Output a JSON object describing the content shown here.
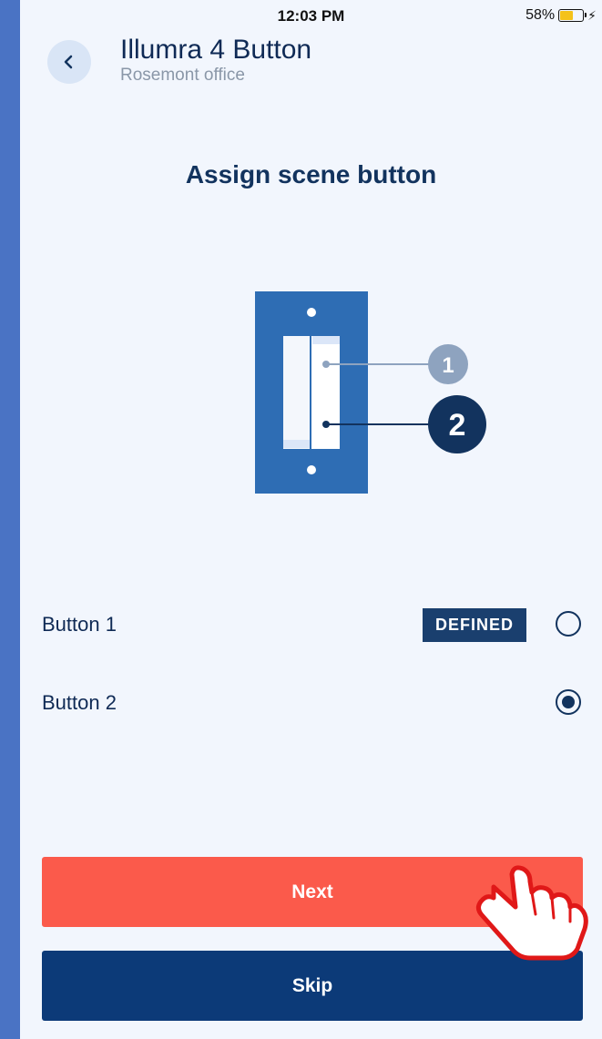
{
  "status_bar": {
    "time": "12:03 PM",
    "battery_percent": "58%",
    "battery_level": 0.58
  },
  "header": {
    "title": "Illumra 4 Button",
    "subtitle": "Rosemont office"
  },
  "section_title": "Assign scene button",
  "illustration": {
    "callout_1": "1",
    "callout_2": "2"
  },
  "options": [
    {
      "label": "Button 1",
      "badge": "DEFINED",
      "selected": false
    },
    {
      "label": "Button 2",
      "badge": "",
      "selected": true
    }
  ],
  "buttons": {
    "next": "Next",
    "skip": "Skip"
  },
  "colors": {
    "background": "#f2f6fd",
    "primary": "#12335e",
    "next_button": "#fb5a4b",
    "skip_button": "#0c3a78",
    "badge": "#1a3f6e",
    "switch_plate": "#2e6db4"
  },
  "icons": [
    "chevron-left-icon",
    "battery-icon",
    "charging-bolt-icon",
    "hand-pointer-icon"
  ]
}
